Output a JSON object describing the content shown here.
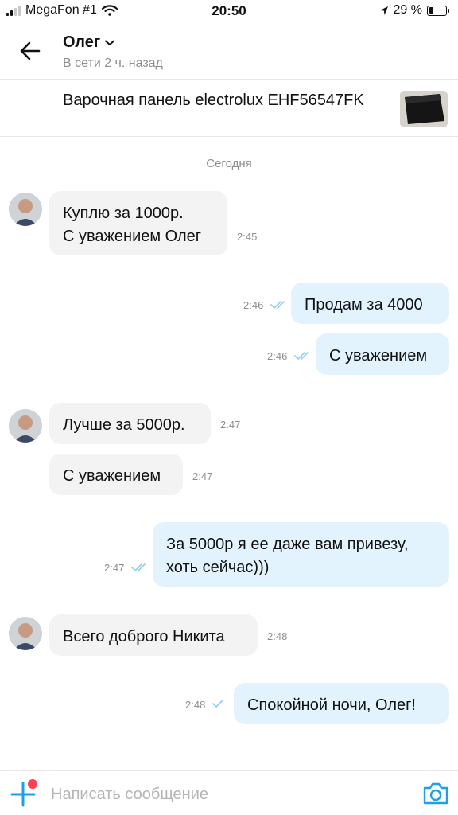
{
  "status_bar": {
    "carrier": "MegaFon #1",
    "time": "20:50",
    "battery": "29 %",
    "battery_level": 0.29
  },
  "header": {
    "contact_name": "Олег",
    "last_seen": "В сети 2 ч. назад"
  },
  "item": {
    "title": "Варочная панель electrolux EHF56547FK"
  },
  "chat": {
    "date_separator": "Сегодня",
    "messages": [
      {
        "direction": "in",
        "text": "Куплю за 1000р.\nС уважением Олег",
        "time": "2:45"
      },
      {
        "direction": "out",
        "text": "Продам за 4000",
        "time": "2:46",
        "status": "read"
      },
      {
        "direction": "out",
        "text": "С уважением",
        "time": "2:46",
        "status": "read"
      },
      {
        "direction": "in",
        "text": "Лучше за 5000р.",
        "time": "2:47"
      },
      {
        "direction": "in",
        "text": "С уважением",
        "time": "2:47"
      },
      {
        "direction": "out",
        "text": "За 5000р я ее даже вам привезу,\nхоть сейчас)))",
        "time": "2:47",
        "status": "read"
      },
      {
        "direction": "in",
        "text": "Всего доброго Никита",
        "time": "2:48"
      },
      {
        "direction": "out",
        "text": "Спокойной ночи, Олег!",
        "time": "2:48",
        "status": "delivered"
      }
    ]
  },
  "composer": {
    "placeholder": "Написать сообщение"
  },
  "colors": {
    "accent": "#1ea0e6",
    "incoming_bubble": "#f3f3f3",
    "outgoing_bubble": "#e2f3fd",
    "notification_dot": "#ff4053",
    "muted_text": "#8e8e8e"
  },
  "icons": [
    "back-arrow-icon",
    "chevron-down-icon",
    "double-check-icon",
    "check-icon",
    "plus-icon",
    "camera-icon",
    "signal-icon",
    "wifi-icon",
    "location-icon",
    "battery-icon"
  ]
}
